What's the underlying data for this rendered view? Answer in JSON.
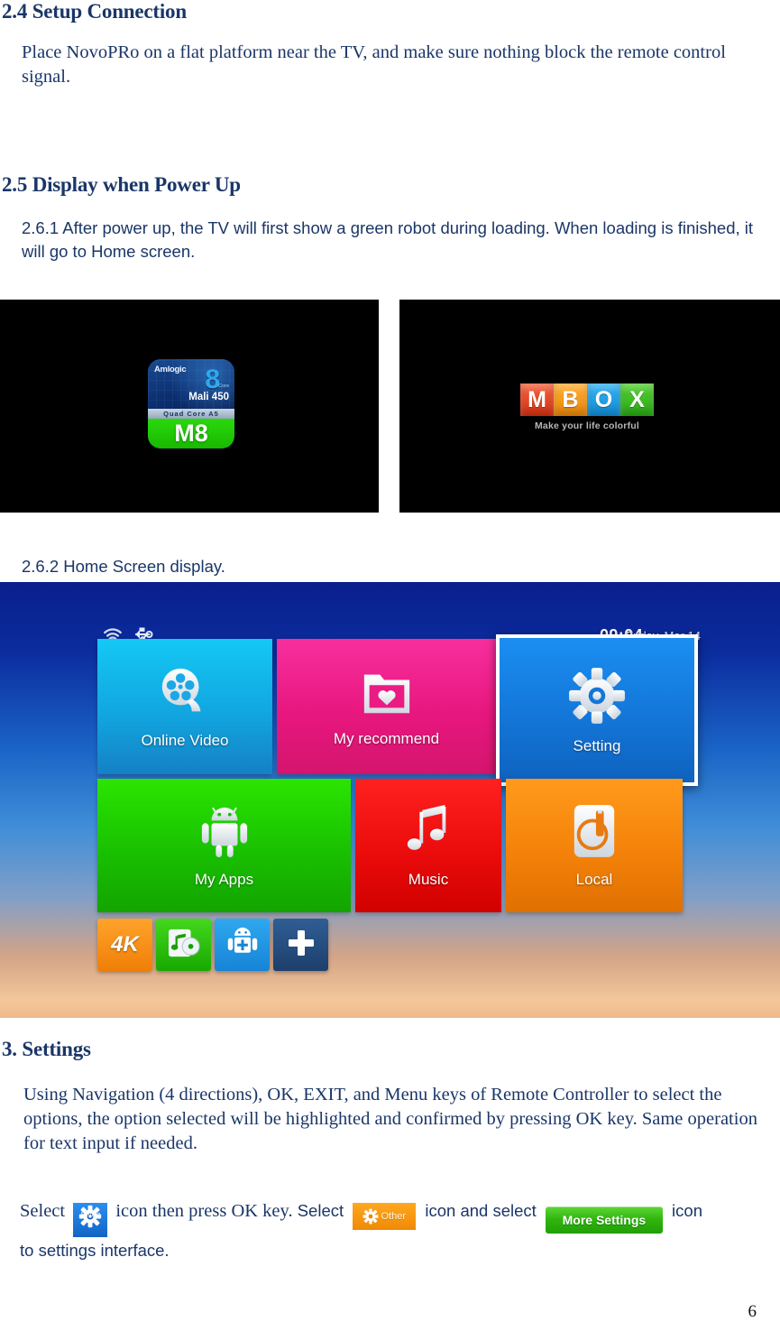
{
  "document": {
    "page_number": "6",
    "sections": [
      {
        "heading": "2.4 Setup Connection",
        "body": "Place NovoPRo on a flat platform near the TV, and make sure nothing block the remote control signal."
      },
      {
        "heading": "2.5 Display when Power Up",
        "body": "2.6.1 After power up, the TV will first show a green robot during loading. When loading is finished, it will go to Home screen."
      },
      {
        "caption": "2.6.2 Home Screen display."
      },
      {
        "heading": "3. Settings",
        "body": "Using Navigation (4 directions), OK, EXIT, and Menu keys of Remote Controller to select the options, the option selected will be highlighted and confirmed by pressing OK key. Same operation for text input if needed."
      }
    ],
    "final_paragraph": {
      "part1": "Select",
      "part2": "icon then press OK key.",
      "part3": "Select",
      "part4": "icon and select",
      "part5": "icon",
      "part6": "to settings interface."
    }
  },
  "boot_splash_left": {
    "brand": "Amlogic",
    "core_number": "8",
    "core_label": "Core",
    "gpu": "Mali 450",
    "cpu_band": "Quad Core A5",
    "chip": "M8"
  },
  "boot_splash_right": {
    "letters": [
      {
        "char": "M",
        "color": "#ee4422"
      },
      {
        "char": "B",
        "color": "#f79a1c"
      },
      {
        "char": "O",
        "color": "#1f9fe6"
      },
      {
        "char": "X",
        "color": "#3dbb28"
      }
    ],
    "tagline": "Make your life colorful"
  },
  "home_screen": {
    "status": {
      "wifi_icon": "wifi-icon",
      "usb_icon": "usb-icon",
      "time": "09:04",
      "date": "Friday, Mar 14"
    },
    "tiles": [
      {
        "label": "Online Video",
        "icon": "film-reel-icon",
        "color": "#11a6e0",
        "selected": false
      },
      {
        "label": "My recommend",
        "icon": "folder-heart-icon",
        "color": "#e8177f",
        "selected": false
      },
      {
        "label": "Setting",
        "icon": "gear-icon",
        "color": "#1376d8",
        "selected": true
      },
      {
        "label": "My Apps",
        "icon": "android-robot-icon",
        "color": "#19c000",
        "selected": false
      },
      {
        "label": "Music",
        "icon": "music-note-icon",
        "color": "#eb0c0c",
        "selected": false
      },
      {
        "label": "Local",
        "icon": "disc-icon",
        "color": "#f4820a",
        "selected": false
      }
    ],
    "shortcuts": [
      {
        "name": "4K",
        "icon": "4k-icon",
        "color": "#ef7f06"
      },
      {
        "name": "Music Player",
        "icon": "music-cd-icon",
        "color": "#18a800"
      },
      {
        "name": "App Installer",
        "icon": "android-plus-icon",
        "color": "#1784d6"
      },
      {
        "name": "Add",
        "icon": "plus-icon",
        "color": "#1d3f6c"
      }
    ]
  },
  "inline_badges": {
    "setting": {
      "label": "Setting",
      "icon": "gear-icon",
      "color": "#1364c4"
    },
    "other": {
      "label": "Other",
      "icon": "gear-icon",
      "color": "#f08a06"
    },
    "more": {
      "label": "More Settings",
      "color": "#2fb50d"
    }
  }
}
